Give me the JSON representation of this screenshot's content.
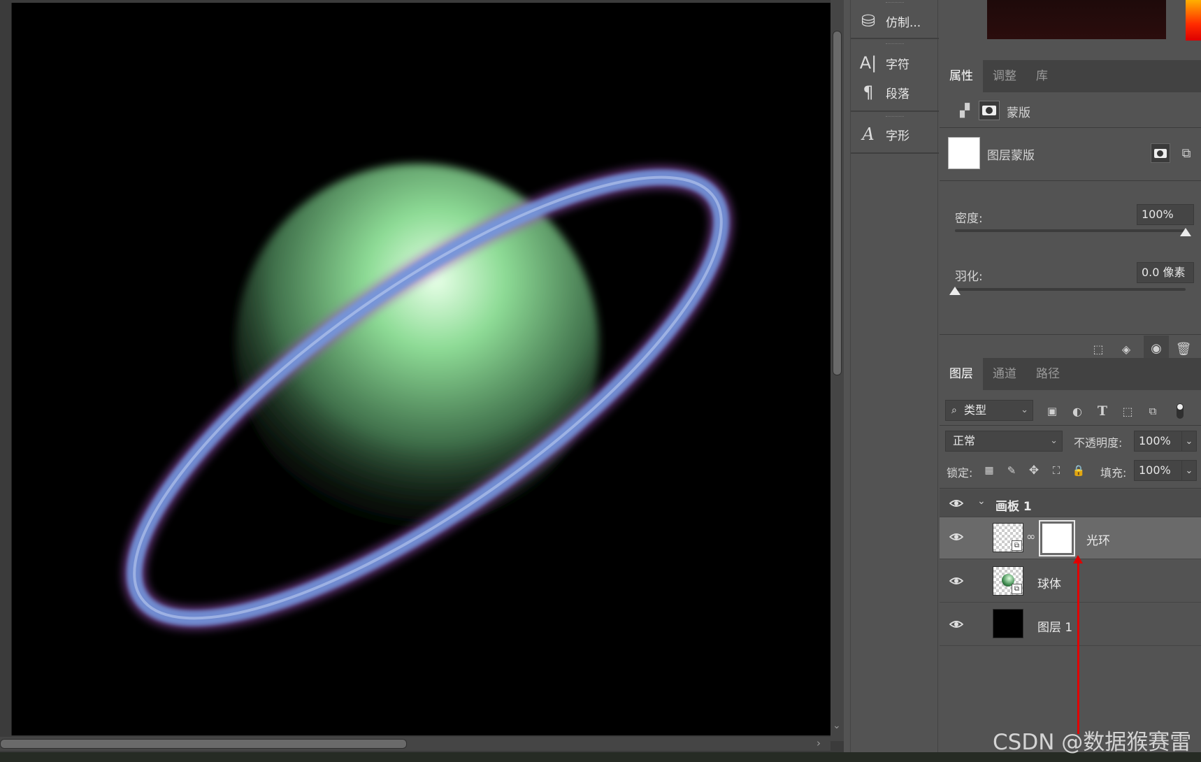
{
  "dock": {
    "clone_label": "仿制...",
    "character_label": "字符",
    "paragraph_label": "段落",
    "glyphs_label": "字形"
  },
  "properties": {
    "tabs": [
      "属性",
      "调整",
      "库"
    ],
    "mask_kind": "蒙版",
    "layer_mask_label": "图层蒙版",
    "density_label": "密度:",
    "density_value": "100%",
    "feather_label": "羽化:",
    "feather_value": "0.0 像素",
    "density_fraction": 1.0,
    "feather_fraction": 0.0
  },
  "layers_panel": {
    "tabs": [
      "图层",
      "通道",
      "路径"
    ],
    "filter_label": "类型",
    "blend_mode": "正常",
    "opacity_label": "不透明度:",
    "opacity_value": "100%",
    "lock_label": "锁定:",
    "fill_label": "填充:",
    "fill_value": "100%",
    "artboard_name": "画板 1",
    "layers": [
      {
        "name": "光环",
        "selected": true,
        "has_mask": true
      },
      {
        "name": "球体",
        "selected": false,
        "has_mask": false
      },
      {
        "name": "图层 1",
        "selected": false,
        "has_mask": false
      }
    ]
  },
  "watermark": "CSDN @数据猴赛雷",
  "colors": {
    "planet": "#7ecf8c",
    "ring_inner": "#6f8fd8",
    "ring_outer": "#b060c0",
    "annotation": "#e00000"
  }
}
